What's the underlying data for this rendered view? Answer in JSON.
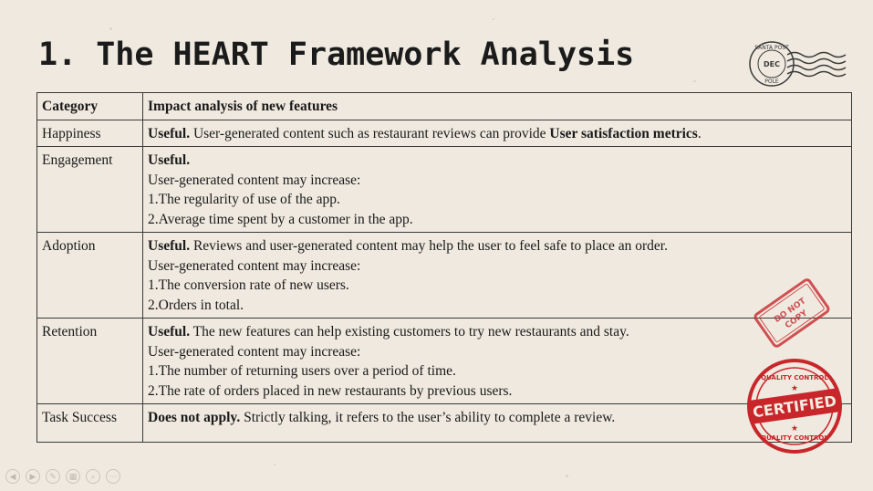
{
  "slide": {
    "title": "1. The HEART Framework Analysis"
  },
  "table": {
    "headers": [
      "Category",
      "Impact analysis of new features"
    ],
    "rows": [
      {
        "category": "Happiness",
        "lead": "Useful.",
        "text": " User-generated content such as restaurant reviews can provide ",
        "emph": "User satisfaction metrics",
        "tail": "."
      },
      {
        "category": "Engagement",
        "lead": "Useful.",
        "lines": [
          "User-generated content may increase:",
          "1.The regularity of use of the app.",
          "2.Average time spent by a customer in the app."
        ]
      },
      {
        "category": "Adoption",
        "lead": "Useful.",
        "text": " Reviews and user-generated content may help the user to feel safe to place an order.",
        "lines": [
          "User-generated content may increase:",
          "1.The conversion rate of new users.",
          "2.Orders in total."
        ]
      },
      {
        "category": "Retention",
        "lead": "Useful.",
        "text": " The new features can help existing customers to try new restaurants and stay.",
        "lines": [
          "User-generated content may increase:",
          "1.The number of returning users over a period of time.",
          "2.The rate of orders placed in new restaurants by previous users."
        ]
      },
      {
        "category": "Task Success",
        "lead": "Does not apply.",
        "text": " Strictly talking, it refers to the user’s ability to complete a review."
      }
    ]
  },
  "decorations": {
    "postmark": {
      "text_top": "SANTA POST",
      "text_mid": "DEC",
      "text_bottom": "POLE"
    },
    "stamp_copy": {
      "text": "DO NOT COPY",
      "color": "#c8262b"
    },
    "stamp_certified": {
      "text": "CERTIFIED",
      "ring_text": "QUALITY CONTROL",
      "color": "#c8262b"
    }
  },
  "controls": [
    {
      "icon": "prev-icon",
      "glyph": "◀"
    },
    {
      "icon": "next-icon",
      "glyph": "▶"
    },
    {
      "icon": "pen-icon",
      "glyph": "✎"
    },
    {
      "icon": "slides-icon",
      "glyph": "▦"
    },
    {
      "icon": "zoom-icon",
      "glyph": "⌕"
    },
    {
      "icon": "more-icon",
      "glyph": "⋯"
    }
  ]
}
